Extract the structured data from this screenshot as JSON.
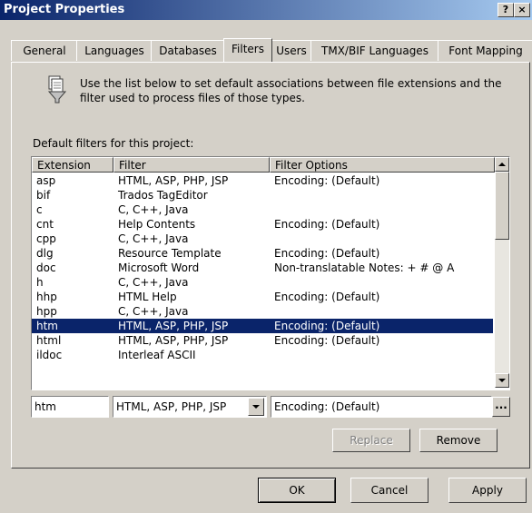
{
  "window": {
    "title": "Project Properties",
    "help_button": "?",
    "close_button": "×"
  },
  "tabs": [
    "General",
    "Languages",
    "Databases",
    "Filters",
    "Users",
    "TMX/BIF Languages",
    "Font Mapping"
  ],
  "active_tab": "Filters",
  "description": "Use the list below to set default associations between file extensions and the filter used to process files of those types.",
  "list_label": "Default filters for this project:",
  "columns": [
    "Extension",
    "Filter",
    "Filter Options"
  ],
  "rows": [
    {
      "ext": "asp",
      "filter": "HTML, ASP, PHP, JSP",
      "options": "Encoding: (Default)"
    },
    {
      "ext": "bif",
      "filter": "Trados TagEditor",
      "options": ""
    },
    {
      "ext": "c",
      "filter": "C, C++, Java",
      "options": ""
    },
    {
      "ext": "cnt",
      "filter": "Help Contents",
      "options": "Encoding: (Default)"
    },
    {
      "ext": "cpp",
      "filter": "C, C++, Java",
      "options": ""
    },
    {
      "ext": "dlg",
      "filter": "Resource Template",
      "options": "Encoding: (Default)"
    },
    {
      "ext": "doc",
      "filter": "Microsoft Word",
      "options": "Non-translatable Notes:  + # @ A"
    },
    {
      "ext": "h",
      "filter": "C, C++, Java",
      "options": ""
    },
    {
      "ext": "hhp",
      "filter": "HTML Help",
      "options": "Encoding: (Default)"
    },
    {
      "ext": "hpp",
      "filter": "C, C++, Java",
      "options": ""
    },
    {
      "ext": "htm",
      "filter": "HTML, ASP, PHP, JSP",
      "options": "Encoding: (Default)"
    },
    {
      "ext": "html",
      "filter": "HTML, ASP, PHP, JSP",
      "options": "Encoding: (Default)"
    },
    {
      "ext": "ildoc",
      "filter": "Interleaf ASCII",
      "options": ""
    }
  ],
  "selected_row": 10,
  "edit": {
    "extension": "htm",
    "filter": "HTML, ASP, PHP, JSP",
    "options": "Encoding: (Default)",
    "browse_label": "..."
  },
  "buttons": {
    "replace": "Replace",
    "remove": "Remove",
    "ok": "OK",
    "cancel": "Cancel",
    "apply": "Apply"
  },
  "colors": {
    "titlebar_start": "#0a246a",
    "titlebar_end": "#a6caf0",
    "selection": "#0a246a",
    "face": "#d4d0c8"
  }
}
